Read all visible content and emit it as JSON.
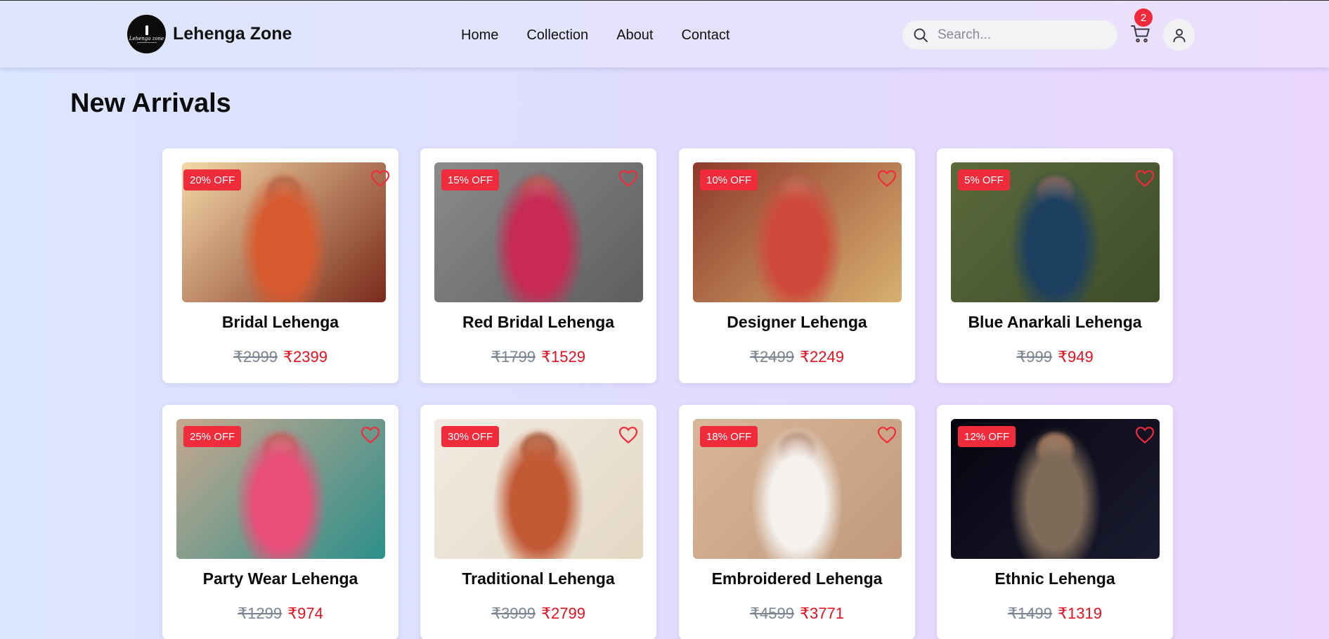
{
  "header": {
    "brand": "Lehenga Zone",
    "logo_text": "Lehenga zone",
    "nav": [
      "Home",
      "Collection",
      "About",
      "Contact"
    ],
    "search_placeholder": "Search...",
    "cart_count": "2"
  },
  "main": {
    "title": "New Arrivals"
  },
  "products": [
    {
      "name": "Bridal Lehenga",
      "discount": "20% OFF",
      "old_price": "₹2999",
      "price": "₹2399",
      "palette": [
        "#f4d9a8",
        "#d85a2f",
        "#7a2a1a"
      ]
    },
    {
      "name": "Red Bridal Lehenga",
      "discount": "15% OFF",
      "old_price": "₹1799",
      "price": "₹1529",
      "palette": [
        "#8a8c8a",
        "#c72a55",
        "#5e5e60"
      ]
    },
    {
      "name": "Designer Lehenga",
      "discount": "10% OFF",
      "old_price": "₹2499",
      "price": "₹2249",
      "palette": [
        "#8e3a2b",
        "#cf4a3b",
        "#d8b070"
      ]
    },
    {
      "name": "Blue Anarkali Lehenga",
      "discount": "5% OFF",
      "old_price": "₹999",
      "price": "₹949",
      "palette": [
        "#5b6a3b",
        "#1d3f60",
        "#3e4d2a"
      ]
    },
    {
      "name": "Party Wear Lehenga",
      "discount": "25% OFF",
      "old_price": "₹1299",
      "price": "₹974",
      "palette": [
        "#c7a88f",
        "#e84f7a",
        "#2d8f8a"
      ]
    },
    {
      "name": "Traditional Lehenga",
      "discount": "30% OFF",
      "old_price": "₹3999",
      "price": "₹2799",
      "palette": [
        "#f1ebe2",
        "#c25a36",
        "#e4d8c4"
      ]
    },
    {
      "name": "Embroidered Lehenga",
      "discount": "18% OFF",
      "old_price": "₹4599",
      "price": "₹3771",
      "palette": [
        "#d9b69a",
        "#f4f1ee",
        "#c29a7b"
      ]
    },
    {
      "name": "Ethnic Lehenga",
      "discount": "12% OFF",
      "old_price": "₹1499",
      "price": "₹1319",
      "palette": [
        "#050510",
        "#7e6a58",
        "#1b1b30"
      ]
    }
  ],
  "colors": {
    "accent": "#ef2b3c",
    "price": "#e3101f",
    "old_price": "#7b8390"
  }
}
